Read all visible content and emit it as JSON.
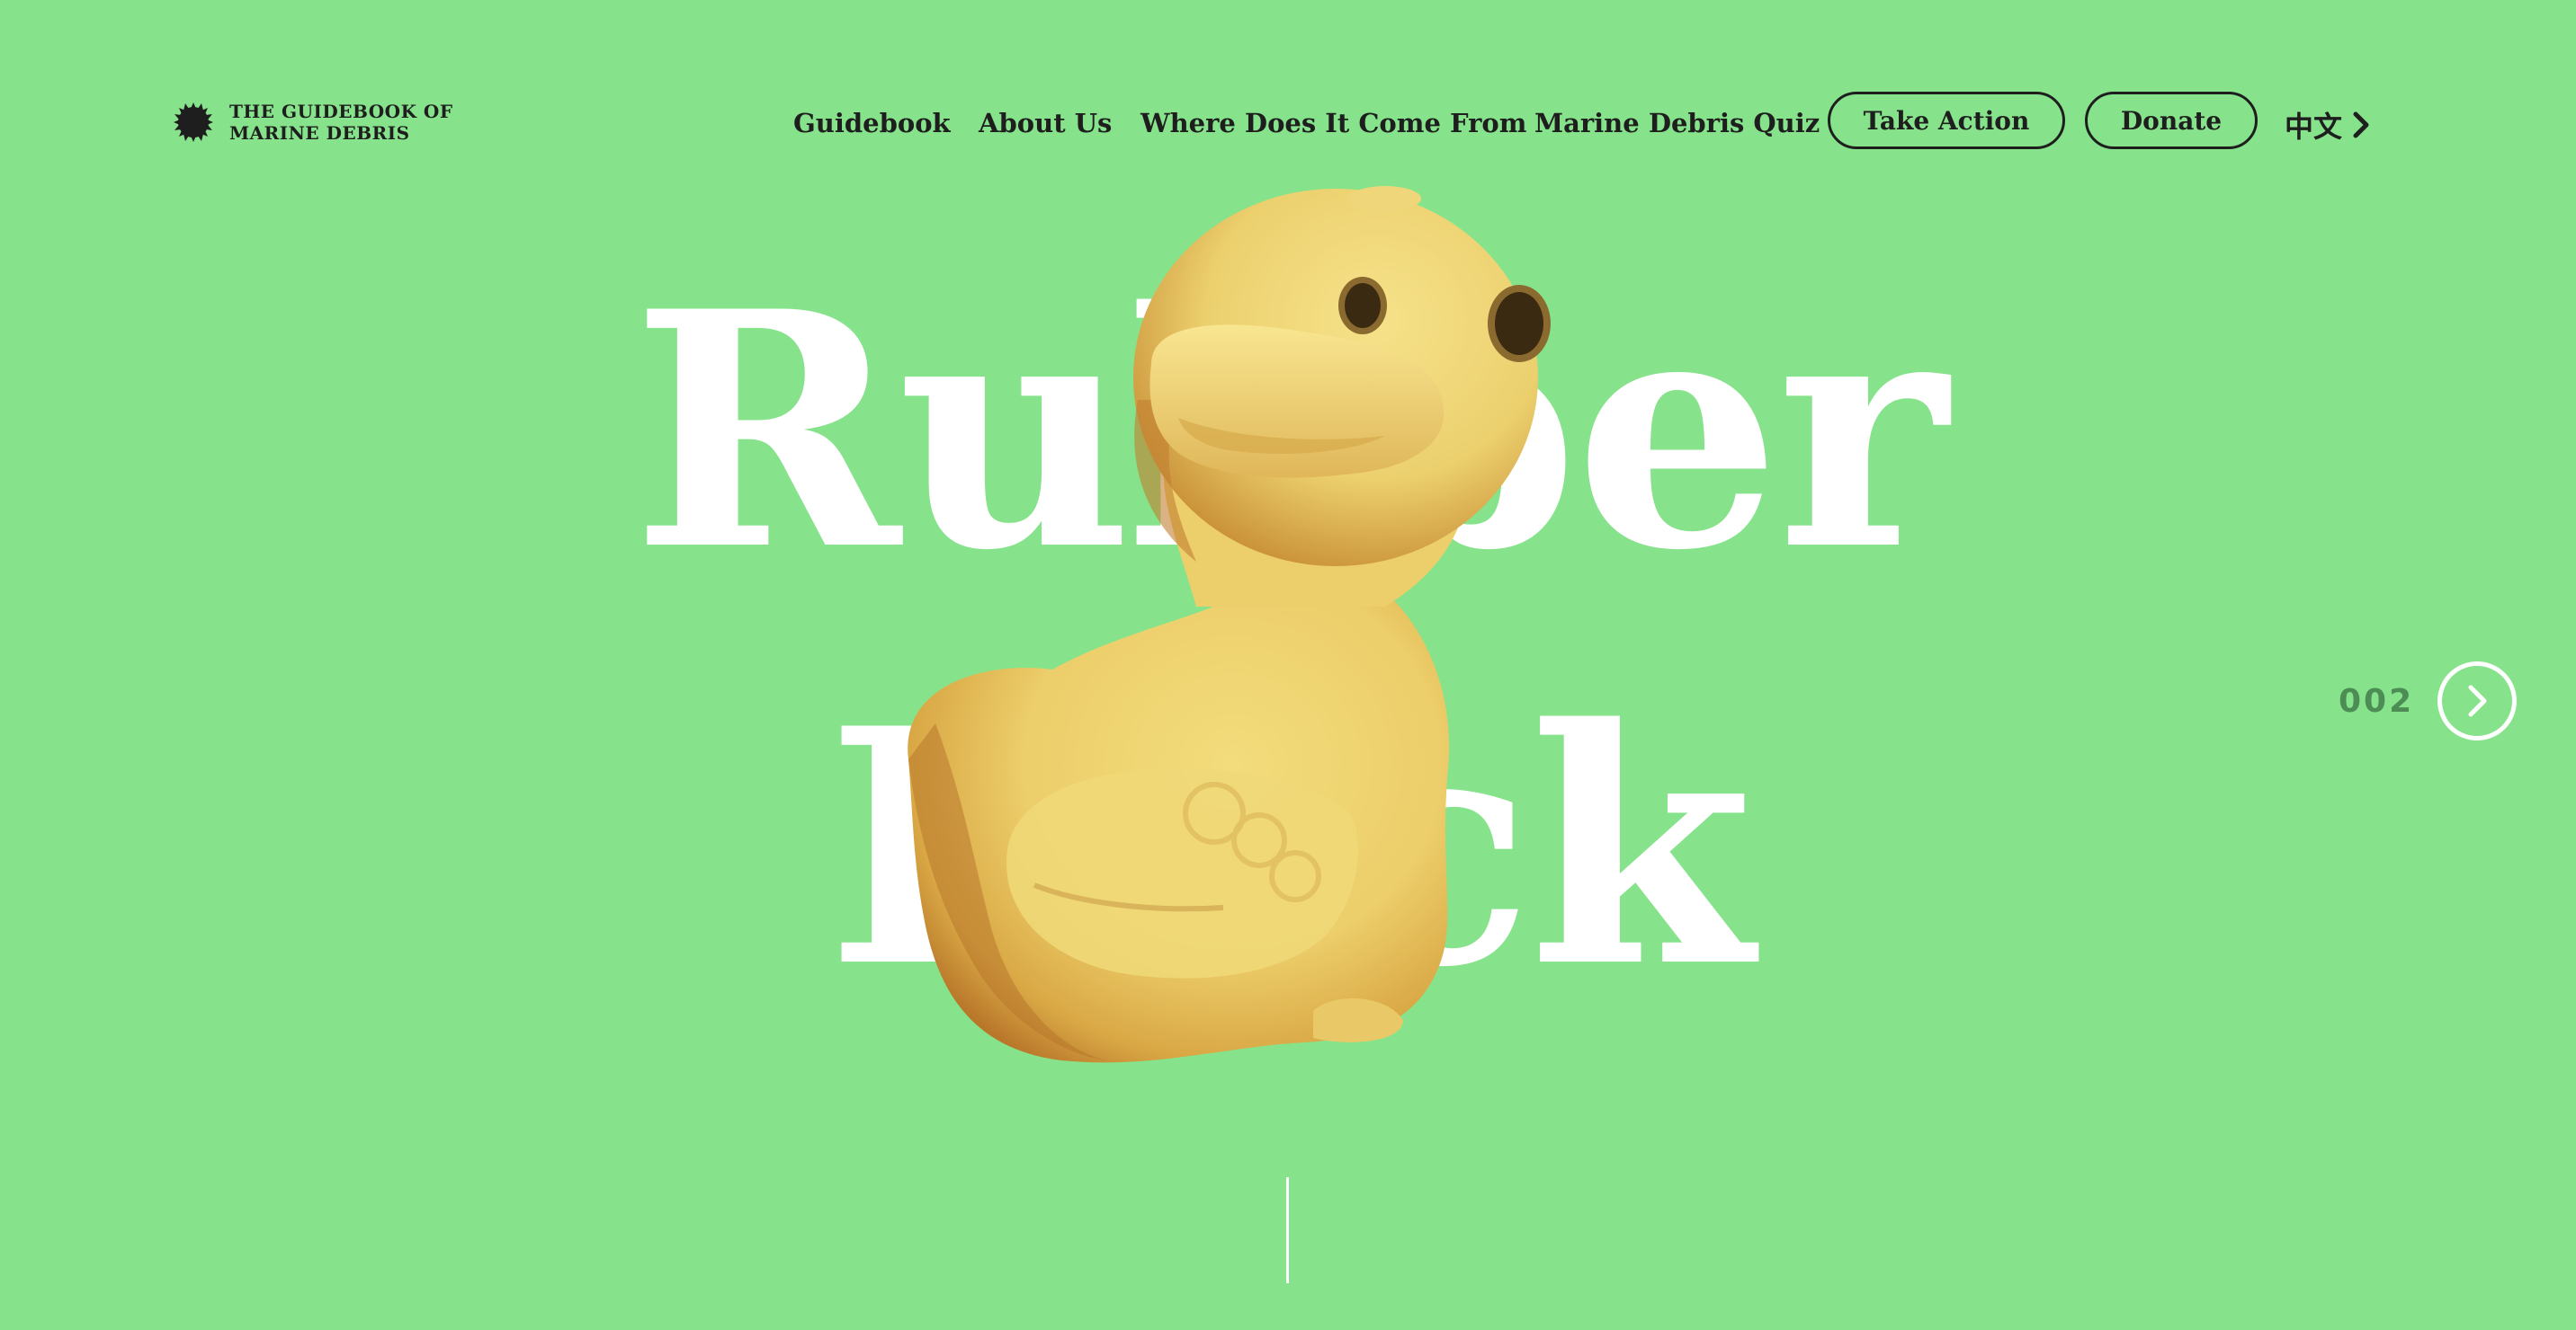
{
  "brand": {
    "line1": "THE GUIDEBOOK OF",
    "line2": "MARINE DEBRIS",
    "logo_icon": "sun-badge-icon"
  },
  "nav": {
    "links": [
      {
        "label": "Guidebook"
      },
      {
        "label": "About Us"
      },
      {
        "label": "Where Does It Come From"
      },
      {
        "label": "Marine Debris Quiz"
      }
    ],
    "take_action": "Take Action",
    "donate": "Donate",
    "language": "中文",
    "language_icon": "chevron-right-icon"
  },
  "hero": {
    "title_line1": "Rubber",
    "title_line2": "Duck",
    "image": "rubber-duck-photo"
  },
  "pager": {
    "number": "002",
    "next_icon": "chevron-right-circle-icon"
  },
  "colors": {
    "background": "#86e38b",
    "text": "#1e1e1e",
    "hero_text": "#ffffff",
    "pager_number": "#4d8d55"
  }
}
